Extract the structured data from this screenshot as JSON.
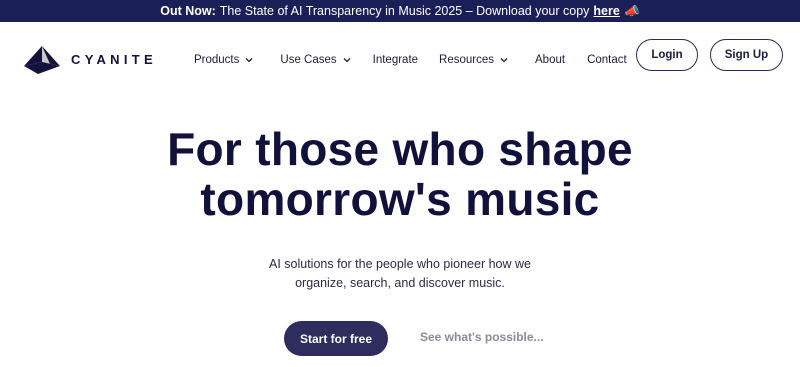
{
  "announcement": {
    "lead": "Out Now:",
    "text": "The State of AI Transparency in Music 2025 – Download your copy",
    "link": "here",
    "emoji_icon": "megaphone-icon"
  },
  "brand": {
    "name": "CYANITE",
    "logo_icon": "cyanite-logo-icon"
  },
  "nav": {
    "items": [
      {
        "label": "Products",
        "dropdown": true
      },
      {
        "label": "Use Cases",
        "dropdown": true
      },
      {
        "label": "Integrate",
        "dropdown": false
      },
      {
        "label": "Resources",
        "dropdown": true
      },
      {
        "label": "About",
        "dropdown": false
      },
      {
        "label": "Contact",
        "dropdown": false
      }
    ],
    "login_label": "Login",
    "signup_label": "Sign Up"
  },
  "hero": {
    "title_line1": "For those who shape",
    "title_line2": "tomorrow's music",
    "subtitle_line1": "AI solutions for the people who pioneer how we",
    "subtitle_line2": "organize, search, and discover music.",
    "primary_cta": "Start for free",
    "secondary_cta": "See what's possible..."
  },
  "colors": {
    "announcement_bg": "#1b1f57",
    "primary": "#2e2d5e",
    "heading": "#11123c",
    "muted": "#8a8b98"
  }
}
